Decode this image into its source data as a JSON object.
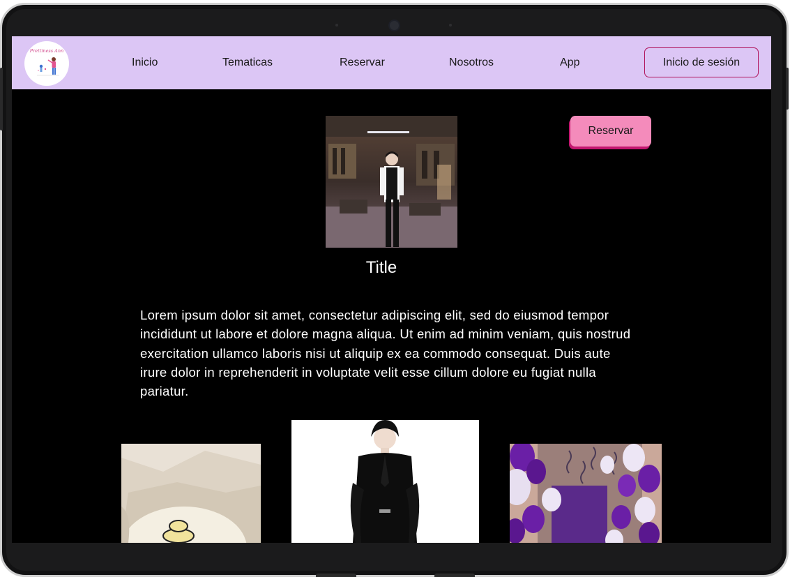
{
  "nav": {
    "logo_text": "Prettiness Ann",
    "links": [
      "Inicio",
      "Tematicas",
      "Reservar",
      "Nosotros",
      "App"
    ],
    "login_label": "Inicio de sesión"
  },
  "hero": {
    "image": "man-in-suit-photo",
    "reserve_label": "Reservar",
    "title": "Title",
    "body": "Lorem ipsum dolor sit amet, consectetur adipiscing elit, sed do eiusmod tempor incididunt ut labore et dolore magna aliqua. Ut enim ad minim veniam, quis nostrud exercitation ullamco laboris nisi ut aliquip ex ea commodo consequat. Duis aute irure dolor in reprehenderit in voluptate velit esse cillum dolore eu fugiat nulla pariatur."
  },
  "gallery": [
    "cake-photo",
    "portrait-photo",
    "purple-balloons-photo"
  ],
  "colors": {
    "navbar": "#dcc6f5",
    "accent_pink": "#f48bbb",
    "accent_magenta": "#b0125a",
    "background": "#000000"
  }
}
